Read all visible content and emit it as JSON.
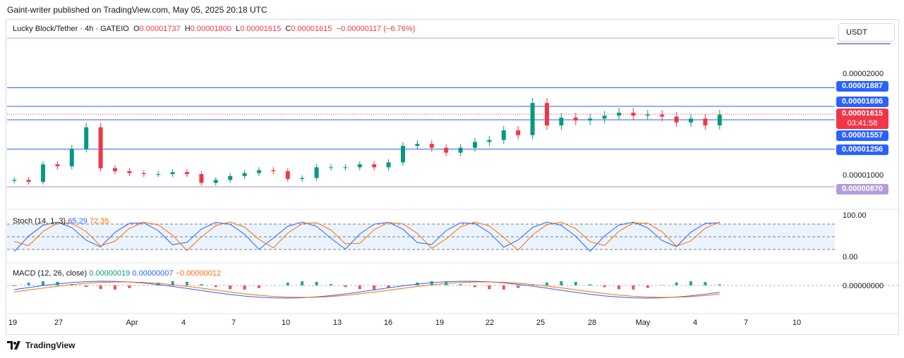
{
  "header": {
    "published": "Gaint-writer published on TradingView.com, May 05, 2025 20:18 UTC"
  },
  "instrument": {
    "name": "Lucky Block/Tether · 4h · GATEIO",
    "o_label": "O",
    "o": "0.00001737",
    "h_label": "H",
    "h": "0.00001800",
    "l_label": "L",
    "l": "0.00001615",
    "c_label": "C",
    "c": "0.00001615",
    "change": "−0.00000117 (−6.76%)"
  },
  "currency_button": "USDT",
  "price_axis": {
    "ticks": [
      "0.00002000",
      "0.00001000",
      "0.00000000",
      "100.00",
      "0.00"
    ],
    "labels": [
      {
        "text": "0.00001887",
        "color": "#2962ff"
      },
      {
        "text": "0.00001696",
        "color": "#2962ff"
      },
      {
        "text": "0.00001615",
        "color": "#f23645"
      },
      {
        "text": "03:41:58",
        "color": "#f23645"
      },
      {
        "text": "0.00001557",
        "color": "#2962ff"
      },
      {
        "text": "0.00001256",
        "color": "#2962ff"
      },
      {
        "text": "0.00000870",
        "color": "#b39ddb"
      }
    ]
  },
  "stoch": {
    "label": "Stoch (14, 1, 3)",
    "k": "65.29",
    "d": "72.35",
    "k_color": "#2962ff",
    "d_color": "#ff6d00"
  },
  "macd": {
    "label": "MACD (12, 26, close)",
    "hist": "0.00000019",
    "macd": "0.00000007",
    "signal": "−0.00000012",
    "hist_color": "#089981",
    "macd_color": "#2962ff",
    "signal_color": "#ff6d00"
  },
  "x_axis": [
    "19",
    "27",
    "Apr",
    "4",
    "7",
    "10",
    "13",
    "16",
    "19",
    "22",
    "25",
    "28",
    "May",
    "4",
    "7",
    "10"
  ],
  "footer": {
    "brand": "TradingView"
  },
  "chart_data": {
    "type": "candlestick",
    "timeframe": "4h",
    "ylim": [
      8.7e-06,
      2.1e-05
    ],
    "horizontal_levels": [
      1.887e-05,
      1.696e-05,
      1.557e-05,
      1.256e-05,
      8.7e-06
    ],
    "current_price": 1.615e-05,
    "candles_close": [
      9.4e-06,
      9.2e-06,
      1.1e-05,
      1.08e-05,
      1.26e-05,
      1.48e-05,
      1.06e-05,
      1.03e-05,
      1.01e-05,
      1e-05,
      1e-05,
      1.02e-05,
      1e-05,
      9.1e-06,
      9.4e-06,
      9.8e-06,
      1.01e-05,
      1.04e-05,
      1.03e-05,
      9.5e-06,
      9.6e-06,
      1.07e-05,
      1.07e-05,
      1.07e-05,
      1.1e-05,
      1.07e-05,
      1.12e-05,
      1.29e-05,
      1.31e-05,
      1.27e-05,
      1.22e-05,
      1.27e-05,
      1.33e-05,
      1.35e-05,
      1.45e-05,
      1.4e-05,
      1.73e-05,
      1.5e-05,
      1.58e-05,
      1.55e-05,
      1.57e-05,
      1.6e-05,
      1.63e-05,
      1.6e-05,
      1.61e-05,
      1.59e-05,
      1.53e-05,
      1.57e-05,
      1.5e-05,
      1.61e-05
    ],
    "stoch_k_range": [
      0,
      100
    ],
    "stoch_band": [
      20,
      80
    ]
  }
}
